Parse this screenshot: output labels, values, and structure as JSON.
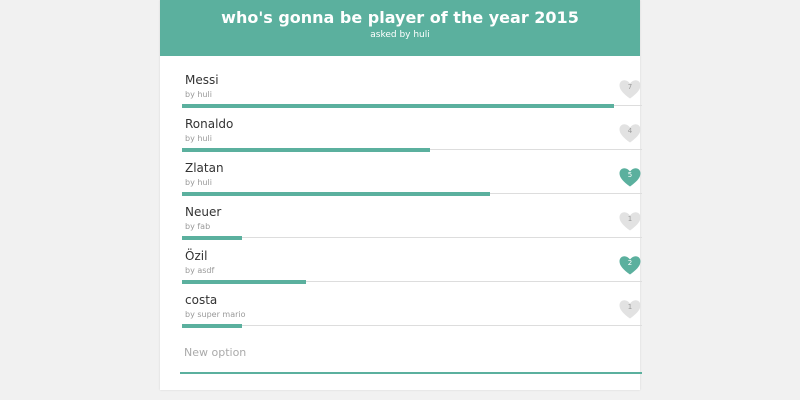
{
  "poll": {
    "title": "who's gonna be player of the year 2015",
    "subtitle": "asked by huli"
  },
  "colors": {
    "accent": "#5bb09e",
    "heart_inactive": "#e2e2e2"
  },
  "options": [
    {
      "name": "Messi",
      "author": "by huli",
      "votes": "7",
      "liked": false,
      "share": 0.94
    },
    {
      "name": "Ronaldo",
      "author": "by huli",
      "votes": "4",
      "liked": false,
      "share": 0.54
    },
    {
      "name": "Zlatan",
      "author": "by huli",
      "votes": "5",
      "liked": true,
      "share": 0.67
    },
    {
      "name": "Neuer",
      "author": "by fab",
      "votes": "1",
      "liked": false,
      "share": 0.13
    },
    {
      "name": "Özil",
      "author": "by asdf",
      "votes": "2",
      "liked": true,
      "share": 0.27
    },
    {
      "name": "costa",
      "author": "by super mario",
      "votes": "1",
      "liked": false,
      "share": 0.13
    }
  ],
  "new_option": {
    "placeholder": "New option",
    "value": ""
  }
}
